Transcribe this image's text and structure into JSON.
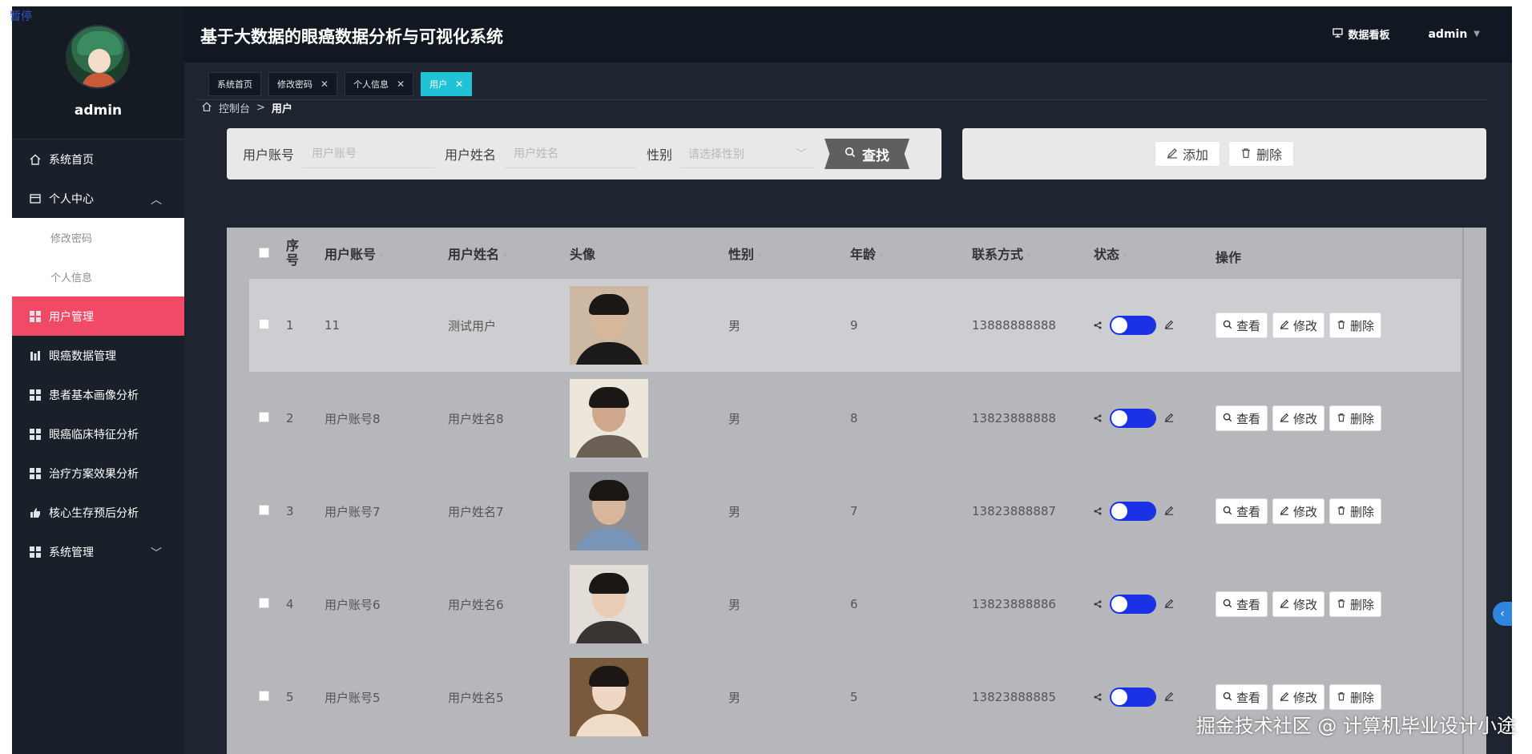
{
  "overlay": {
    "pause_label": "暂停"
  },
  "sidebar": {
    "username": "admin",
    "items": [
      {
        "label": "系统首页",
        "icon": "home-icon"
      },
      {
        "label": "个人中心",
        "icon": "card-icon"
      },
      {
        "label": "修改密码"
      },
      {
        "label": "个人信息"
      },
      {
        "label": "用户管理",
        "icon": "grid-icon"
      },
      {
        "label": "眼癌数据管理",
        "icon": "bar-icon"
      },
      {
        "label": "患者基本画像分析",
        "icon": "grid-icon"
      },
      {
        "label": "眼癌临床特征分析",
        "icon": "grid-icon"
      },
      {
        "label": "治疗方案效果分析",
        "icon": "grid-icon"
      },
      {
        "label": "核心生存预后分析",
        "icon": "thumb-icon"
      },
      {
        "label": "系统管理",
        "icon": "grid-icon"
      }
    ],
    "active_color": "#f04a66"
  },
  "header": {
    "title": "基于大数据的眼癌数据分析与可视化系统",
    "dashboard_label": "数据看板",
    "user_label": "admin"
  },
  "tabs": [
    {
      "label": "系统首页"
    },
    {
      "label": "修改密码",
      "close": "✕"
    },
    {
      "label": "个人信息",
      "close": "✕"
    },
    {
      "label": "用户",
      "close": "✕"
    }
  ],
  "breadcrumb": {
    "root": "控制台",
    "separator": ">",
    "current": "用户"
  },
  "search": {
    "account_label": "用户账号",
    "account_placeholder": "用户账号",
    "name_label": "用户姓名",
    "name_placeholder": "用户姓名",
    "gender_label": "性别",
    "gender_placeholder": "请选择性别",
    "search_button": "查找"
  },
  "actions": {
    "add_button": "添加",
    "delete_button": "删除"
  },
  "table": {
    "headers": {
      "index_line1": "序",
      "index_line2": "号",
      "account": "用户账号",
      "name": "用户姓名",
      "avatar": "头像",
      "gender": "性别",
      "age": "年龄",
      "phone": "联系方式",
      "status": "状态",
      "ops": "操作"
    },
    "rows": [
      {
        "index": "1",
        "account": "11",
        "name": "测试用户",
        "gender": "男",
        "age": "9",
        "phone": "13888888888",
        "view": "查看",
        "edit": "修改",
        "del": "删除"
      },
      {
        "index": "2",
        "account": "用户账号8",
        "name": "用户姓名8",
        "gender": "男",
        "age": "8",
        "phone": "13823888888",
        "view": "查看",
        "edit": "修改",
        "del": "删除"
      },
      {
        "index": "3",
        "account": "用户账号7",
        "name": "用户姓名7",
        "gender": "男",
        "age": "7",
        "phone": "13823888887",
        "view": "查看",
        "edit": "修改",
        "del": "删除"
      },
      {
        "index": "4",
        "account": "用户账号6",
        "name": "用户姓名6",
        "gender": "男",
        "age": "6",
        "phone": "13823888886",
        "view": "查看",
        "edit": "修改",
        "del": "删除"
      },
      {
        "index": "5",
        "account": "用户账号5",
        "name": "用户姓名5",
        "gender": "男",
        "age": "5",
        "phone": "13823888885",
        "view": "查看",
        "edit": "修改",
        "del": "删除"
      }
    ]
  },
  "watermark": "掘金技术社区 @ 计算机毕业设计小途",
  "colors": {
    "tab_active": "#20c3d6",
    "toggle_on": "#1a31e6",
    "menu_active": "#f04a66"
  }
}
